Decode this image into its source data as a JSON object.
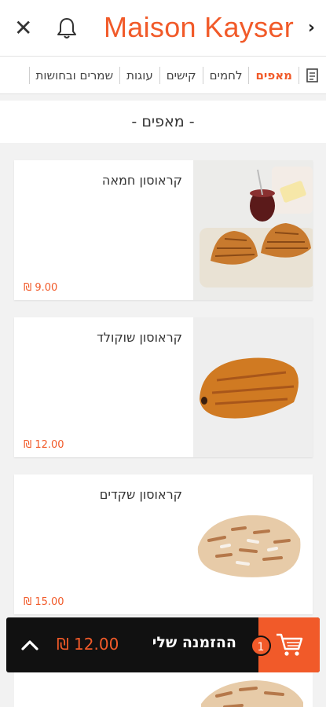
{
  "header": {
    "title": "Maison Kayser",
    "close_icon": "close-icon",
    "bell_icon": "bell-icon",
    "back_icon": "chevron-right-icon"
  },
  "categories": [
    {
      "label": "מאפים",
      "active": true
    },
    {
      "label": "לחמים",
      "active": false
    },
    {
      "label": "קישים",
      "active": false
    },
    {
      "label": "עוגות",
      "active": false
    },
    {
      "label": "שמרים ובחושות",
      "active": false
    }
  ],
  "section": {
    "title": "- מאפים -"
  },
  "products": [
    {
      "name": "קראוסון חמאה",
      "price": "₪ 9.00"
    },
    {
      "name": "קראוסון שוקולד",
      "price": "₪ 12.00"
    },
    {
      "name": "קראוסון שקדים",
      "price": "₪ 15.00"
    }
  ],
  "order": {
    "label": "ההזמנה שלי",
    "count": "1",
    "total": "₪ 12.00"
  },
  "colors": {
    "accent": "#f15a29",
    "bar": "#111111"
  }
}
